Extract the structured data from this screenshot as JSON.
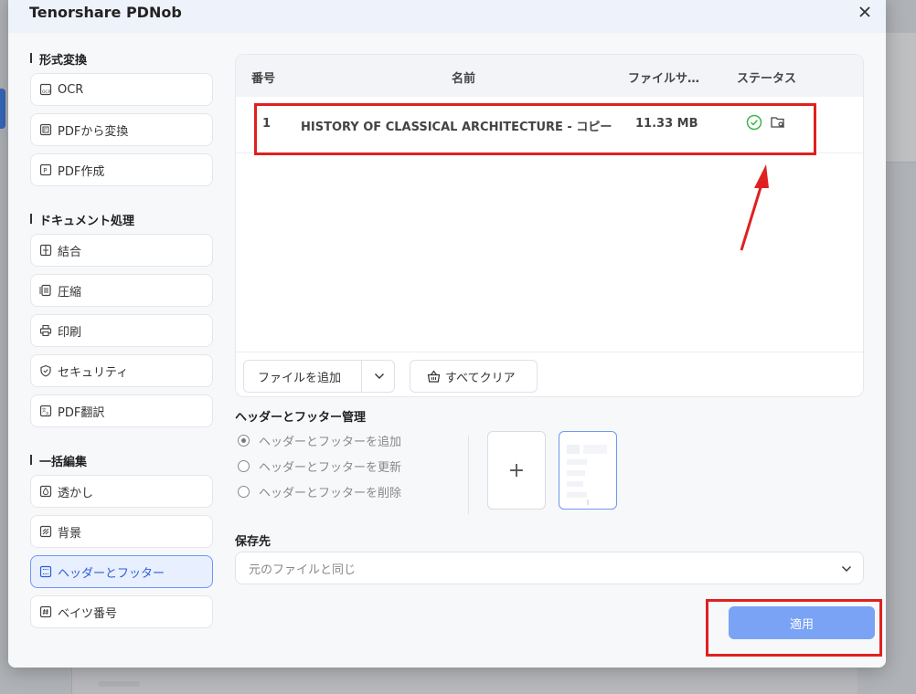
{
  "app": {
    "title": "Tenorshare PDNob"
  },
  "sidebar": {
    "sections": [
      {
        "title": "形式変換",
        "items": [
          {
            "label": "OCR"
          },
          {
            "label": "PDFから変換"
          },
          {
            "label": "PDF作成"
          }
        ]
      },
      {
        "title": "ドキュメント処理",
        "items": [
          {
            "label": "結合"
          },
          {
            "label": "圧縮"
          },
          {
            "label": "印刷"
          },
          {
            "label": "セキュリティ"
          },
          {
            "label": "PDF翻訳"
          }
        ]
      },
      {
        "title": "一括編集",
        "items": [
          {
            "label": "透かし"
          },
          {
            "label": "背景"
          },
          {
            "label": "ヘッダーとフッター",
            "active": true
          },
          {
            "label": "ベイツ番号"
          }
        ]
      }
    ]
  },
  "file_table": {
    "columns": {
      "number": "番号",
      "name": "名前",
      "size": "ファイルサ…",
      "status": "ステータス"
    },
    "rows": [
      {
        "number": "1",
        "name": "HISTORY OF CLASSICAL ARCHITECTURE - コピー",
        "size": "11.33 MB",
        "status_icons": [
          "check-circle-icon",
          "folder-search-icon"
        ]
      }
    ],
    "add_file_label": "ファイルを追加",
    "clear_all_label": "すべてクリア"
  },
  "header_footer": {
    "title": "ヘッダーとフッター管理",
    "options": [
      {
        "label": "ヘッダーとフッターを追加",
        "checked": true
      },
      {
        "label": "ヘッダーとフッターを更新",
        "checked": false
      },
      {
        "label": "ヘッダーとフッターを削除",
        "checked": false
      }
    ],
    "add_template_symbol": "+"
  },
  "save": {
    "title": "保存先",
    "value": "元のファイルと同じ"
  },
  "apply_label": "適用",
  "colors": {
    "accent": "#2b5fd9",
    "apply": "#7aa3f6",
    "success": "#3db54a",
    "annotation": "#e02020"
  }
}
